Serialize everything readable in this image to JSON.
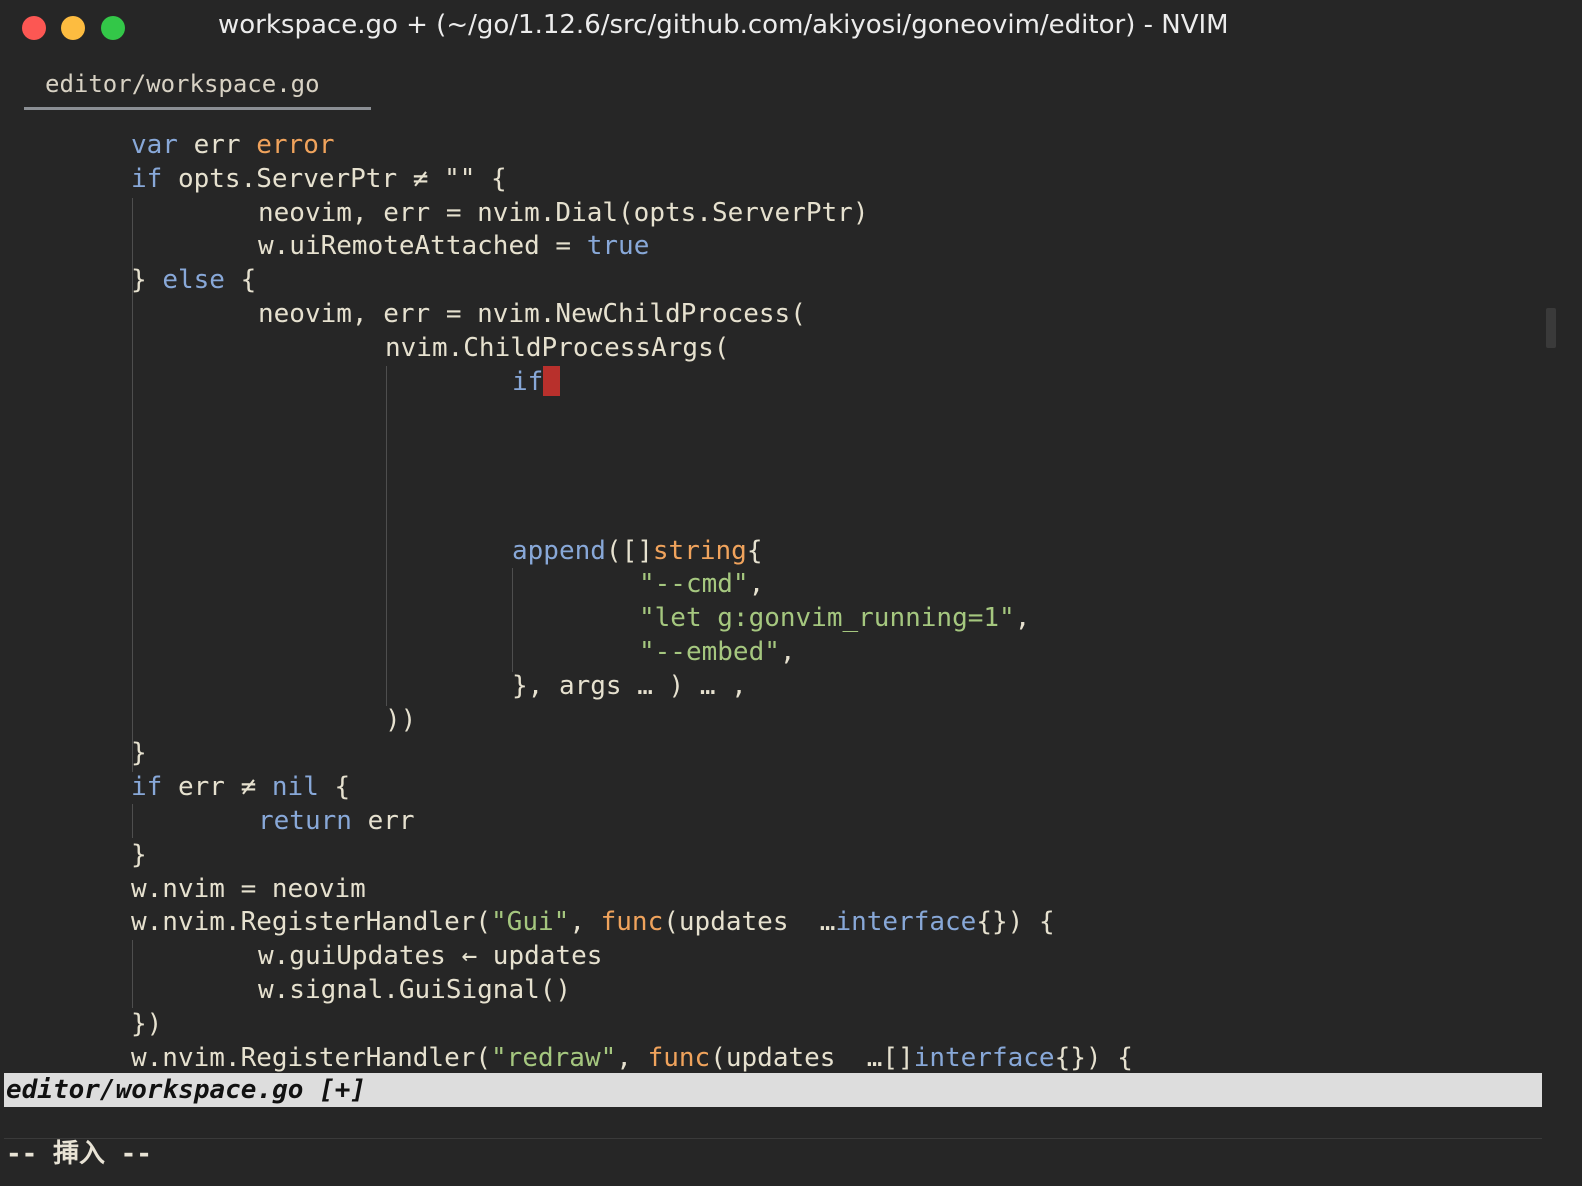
{
  "window": {
    "title": "workspace.go + (~/go/1.12.6/src/github.com/akiyosi/goneovim/editor) - NVIM"
  },
  "tab": {
    "label": "editor/workspace.go"
  },
  "code_lines": [
    [
      [
        "var ",
        "kw"
      ],
      [
        "err ",
        ""
      ],
      [
        "error",
        "ty"
      ]
    ],
    [
      [
        "if ",
        "kw"
      ],
      [
        "opts.ServerPtr ≠ \"\" {",
        ""
      ]
    ],
    [
      [
        "neovim, err = nvim.Dial(opts.ServerPtr)",
        ""
      ]
    ],
    [
      [
        "w.uiRemoteAttached = ",
        ""
      ],
      [
        "true",
        "kw"
      ]
    ],
    [
      [
        "} ",
        ""
      ],
      [
        "else",
        "kw"
      ],
      [
        " {",
        ""
      ]
    ],
    [
      [
        "neovim, err = nvim.NewChildProcess(",
        ""
      ]
    ],
    [
      [
        "nvim.ChildProcessArgs(",
        ""
      ]
    ],
    [
      [
        "if",
        "kw"
      ]
    ],
    [],
    [],
    [],
    [],
    [
      [
        "append",
        "kw"
      ],
      [
        "([]",
        ""
      ],
      [
        "string",
        "ty"
      ],
      [
        "{",
        ""
      ]
    ],
    [
      [
        "\"--cmd\"",
        "str"
      ],
      [
        ",",
        ""
      ]
    ],
    [
      [
        "\"let g:gonvim_running=1\"",
        "str"
      ],
      [
        ",",
        ""
      ]
    ],
    [
      [
        "\"--embed\"",
        "str"
      ],
      [
        ",",
        ""
      ]
    ],
    [
      [
        "}, args … ) … ,",
        ""
      ]
    ],
    [
      [
        "))",
        ""
      ]
    ],
    [
      [
        "}",
        ""
      ]
    ],
    [
      [
        "if ",
        "kw"
      ],
      [
        "err ≠ ",
        ""
      ],
      [
        "nil",
        "kw"
      ],
      [
        " {",
        ""
      ]
    ],
    [
      [
        "return",
        "kw"
      ],
      [
        " err",
        ""
      ]
    ],
    [
      [
        "}",
        ""
      ]
    ],
    [
      [
        "w.nvim = neovim",
        ""
      ]
    ],
    [
      [
        "w.nvim.RegisterHandler(",
        ""
      ],
      [
        "\"Gui\"",
        "str"
      ],
      [
        ", ",
        ""
      ],
      [
        "func",
        "ty"
      ],
      [
        "(updates  …",
        ""
      ],
      [
        "interface",
        "kw"
      ],
      [
        "{}) {",
        ""
      ]
    ],
    [
      [
        "w.guiUpdates ← updates",
        ""
      ]
    ],
    [
      [
        "w.signal.GuiSignal()",
        ""
      ]
    ],
    [
      [
        "})",
        ""
      ]
    ],
    [
      [
        "w.nvim.RegisterHandler(",
        ""
      ],
      [
        "\"redraw\"",
        "str"
      ],
      [
        ", ",
        ""
      ],
      [
        "func",
        "ty"
      ],
      [
        "(updates  …[]",
        ""
      ],
      [
        "interface",
        "kw"
      ],
      [
        "{}) {",
        ""
      ]
    ]
  ],
  "statusline": {
    "text": "editor/workspace.go [+]"
  },
  "mode": {
    "text": "-- 挿入 --"
  }
}
